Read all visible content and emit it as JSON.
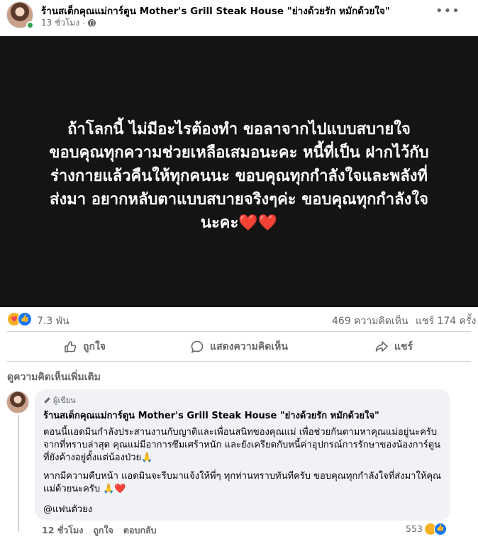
{
  "post": {
    "page_name": "ร้านสเต็กคุณแม่การ์ตูน Mother's Grill Steak House \"ย่างด้วยรัก หมักด้วยใจ\"",
    "time": "13 ชั่วโมง",
    "dot": "·",
    "more_icon": "ellipsis-icon",
    "image_text_lines": [
      "ถ้าโลกนี้ ไม่มีอะไรต้องทำ ขอลาจากไปแบบสบายใจ",
      "ขอบคุณทุกความช่วยเหลือเสมอนะคะ หนี้ที่เป็น ฝากไว้กับ",
      "ร่างกายแล้วคืนให้ทุกคนนะ ขอบคุณทุกกำลังใจและพลังที่",
      "ส่งมา อยากหลับตาแบบสบายจริงๆค่ะ ขอบคุณทุกกำลังใจ",
      "นะคะ❤️❤️"
    ]
  },
  "stats": {
    "reactions": "7.3 พัน",
    "comments": "469 ความคิดเห็น",
    "shares": "แชร์ 174 ครั้ง"
  },
  "actions": {
    "like": "ถูกใจ",
    "comment": "แสดงความคิดเห็น",
    "share": "แชร์"
  },
  "more_comments_label": "ดูความคิดเห็นเพิ่มเติม",
  "comment": {
    "badge": "ผู้เขียน",
    "author": "ร้านสเต็กคุณแม่การ์ตูน Mother's Grill Steak House \"ย่างด้วยรัก หมักด้วยใจ\"",
    "paragraph1": "ตอนนี้แอดมินกำลังประสานงานกับญาติและเพื่อนสนิทของคุณแม่ เพื่อช่วยกันตามหาคุณแม่อยู่นะครับ จากที่ทราบล่าสุด คุณแม่มีอาการซึมเศร้าหนัก และยังเครียดกับหนี้ค่าอุปกรณ์การรักษาของน้องการ์ตูนที่ยังค้างอยู่ตั้งแต่น้องป่วย🙏",
    "paragraph2": "หากมีความคืบหน้า แอดมินจะรีบมาแจ้งให้พี่ๆ ทุกท่านทราบทันทีครับ ขอบคุณทุกกำลังใจที่ส่งมาให้คุณแม่ด้วยนะครับ 🙏❤️",
    "signature": "@แฟนตัวยง",
    "time": "12 ชั่วโมง",
    "like": "ถูกใจ",
    "reply": "ตอบกลับ",
    "reaction_count": "553"
  }
}
